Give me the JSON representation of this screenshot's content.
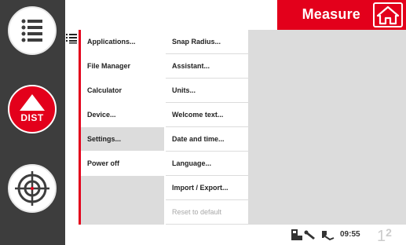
{
  "header": {
    "title": "Measure",
    "accent_color": "#e3001b"
  },
  "left_buttons": {
    "menu_icon": "list-menu-icon",
    "dist_label": "DIST",
    "target_icon": "target-crosshair-icon"
  },
  "menu_level1": [
    {
      "label": "Applications...",
      "selected": false
    },
    {
      "label": "File Manager",
      "selected": false
    },
    {
      "label": "Calculator",
      "selected": false
    },
    {
      "label": "Device...",
      "selected": false
    },
    {
      "label": "Settings...",
      "selected": true
    },
    {
      "label": "Power off",
      "selected": false
    }
  ],
  "menu_level2": [
    {
      "label": "Snap Radius...",
      "enabled": true
    },
    {
      "label": "Assistant...",
      "enabled": true
    },
    {
      "label": "Units...",
      "enabled": true
    },
    {
      "label": "Welcome text...",
      "enabled": true
    },
    {
      "label": "Date and time...",
      "enabled": true
    },
    {
      "label": "Language...",
      "enabled": true
    },
    {
      "label": "Import / Export...",
      "enabled": true
    },
    {
      "label": "Reset to default",
      "enabled": false
    }
  ],
  "status_bar": {
    "time": "09:55",
    "page_current": "1",
    "page_total": "2",
    "icons": [
      "battery-icon",
      "laser-pointer-icon",
      "connection-plug-icon"
    ]
  }
}
